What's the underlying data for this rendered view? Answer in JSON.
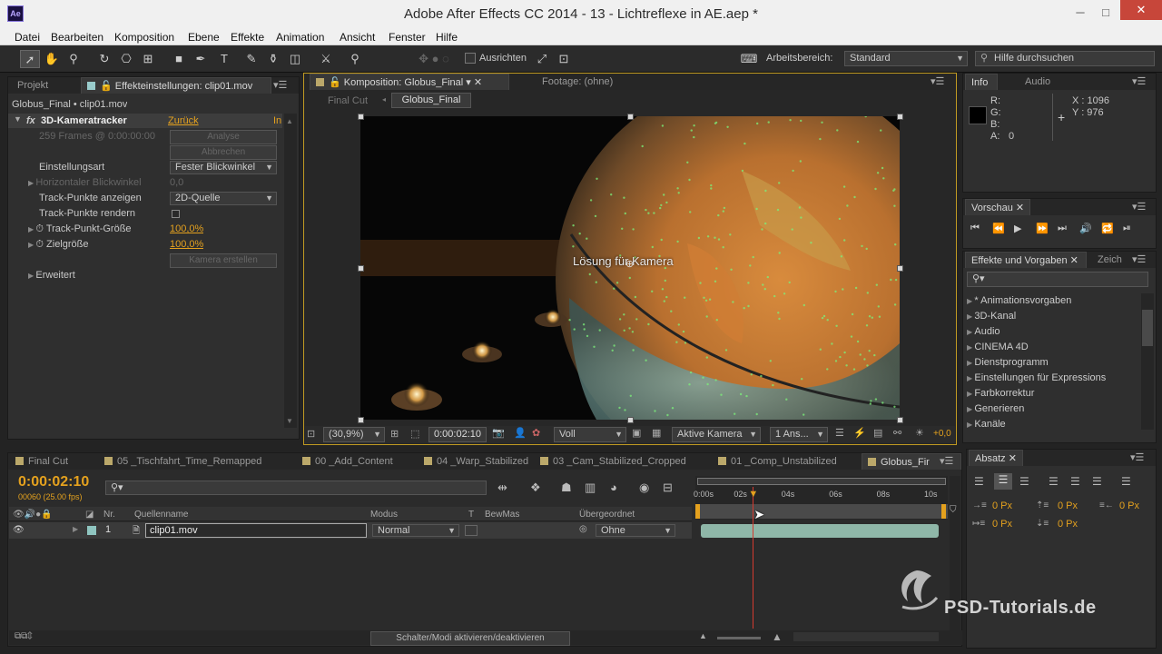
{
  "app": {
    "logo": "Ae",
    "title": "Adobe After Effects CC 2014 - 13 - Lichtreflexe in AE.aep *",
    "window_controls": {
      "minimize": "─",
      "maximize": "□",
      "close": "✕"
    }
  },
  "menu": [
    "Datei",
    "Bearbeiten",
    "Komposition",
    "Ebene",
    "Effekte",
    "Animation",
    "Ansicht",
    "Fenster",
    "Hilfe"
  ],
  "toolbar": {
    "align_label": "Ausrichten",
    "workspace_label": "Arbeitsbereich:",
    "workspace_value": "Standard",
    "search_placeholder": "Hilfe durchsuchen"
  },
  "effects_panel": {
    "tab_project": "Projekt",
    "tab_effects": "Effekteinstellungen: clip01.mov",
    "breadcrumb": "Globus_Final • clip01.mov",
    "effect_name": "3D-Kameratracker",
    "fx": "fx",
    "reset": "Zurück",
    "info": "In",
    "frames_status": "259 Frames @ 0:00:00:00",
    "btn_analyse": "Analyse",
    "btn_cancel": "Abbrechen",
    "rows": [
      {
        "label": "Einstellungsart",
        "value": "Fester Blickwinkel"
      },
      {
        "label": "Horizontaler Blickwinkel",
        "value": "0,0"
      },
      {
        "label": "Track-Punkte anzeigen",
        "value": "2D-Quelle"
      },
      {
        "label": "Track-Punkte rendern",
        "value": ""
      },
      {
        "label": "Track-Punkt-Größe",
        "value": "100,0%"
      },
      {
        "label": "Zielgröße",
        "value": "100,0%"
      }
    ],
    "btn_create_camera": "Kamera erstellen",
    "advanced": "Erweitert"
  },
  "viewer": {
    "tab_comp": "Komposition: Globus_Final",
    "tab_footage": "Footage: (ohne)",
    "crumb_final_cut": "Final Cut",
    "crumb_globus": "Globus_Final",
    "overlay_text": "Lösung für Kamera",
    "zoom": "(30,9%)",
    "timecode": "0:00:02:10",
    "resolution": "Voll",
    "camera": "Aktive Kamera",
    "views": "1 Ans...",
    "exposure": "+0,0"
  },
  "info_panel": {
    "tab_info": "Info",
    "tab_audio": "Audio",
    "r": "R:",
    "g": "G:",
    "b": "B:",
    "a": "A:",
    "a_value": "0",
    "x": "X : 1096",
    "y": "Y : 976"
  },
  "preview_panel": {
    "tab": "Vorschau"
  },
  "effects_presets": {
    "tab": "Effekte und Vorgaben",
    "tab2": "Zeich",
    "items": [
      "* Animationsvorgaben",
      "3D-Kanal",
      "Audio",
      "CINEMA 4D",
      "Dienstprogramm",
      "Einstellungen für Expressions",
      "Farbkorrektur",
      "Generieren",
      "Kanäle"
    ]
  },
  "paragraph_panel": {
    "tab": "Absatz",
    "values": [
      "0 Px",
      "0 Px",
      "0 Px",
      "0 Px",
      "0 Px"
    ]
  },
  "timeline": {
    "tabs": [
      "Final Cut",
      "05 _Tischfahrt_Time_Remapped",
      "00 _Add_Content",
      "04 _Warp_Stabilized",
      "03 _Cam_Stabilized_Cropped",
      "01 _Comp_Unstabilized",
      "Globus_Fir"
    ],
    "timecode": "0:00:02:10",
    "frames": "00060 (25.00 fps)",
    "columns": {
      "nr": "Nr.",
      "source": "Quellenname",
      "mode": "Modus",
      "t": "T",
      "trkmat": "BewMas",
      "parent": "Übergeordnet"
    },
    "layer": {
      "nr": "1",
      "name": "clip01.mov",
      "mode": "Normal",
      "parent": "Ohne"
    },
    "ruler": [
      "0:00s",
      "02s",
      "04s",
      "06s",
      "08s",
      "10s"
    ],
    "toggle_label": "Schalter/Modi aktivieren/deaktivieren",
    "playhead_fraction": 0.22
  },
  "watermark": "PSD-Tutorials.de",
  "colors": {
    "accent": "#e4a11e",
    "playhead": "#d43a2f",
    "clip_bar": "#8fb7a8"
  }
}
